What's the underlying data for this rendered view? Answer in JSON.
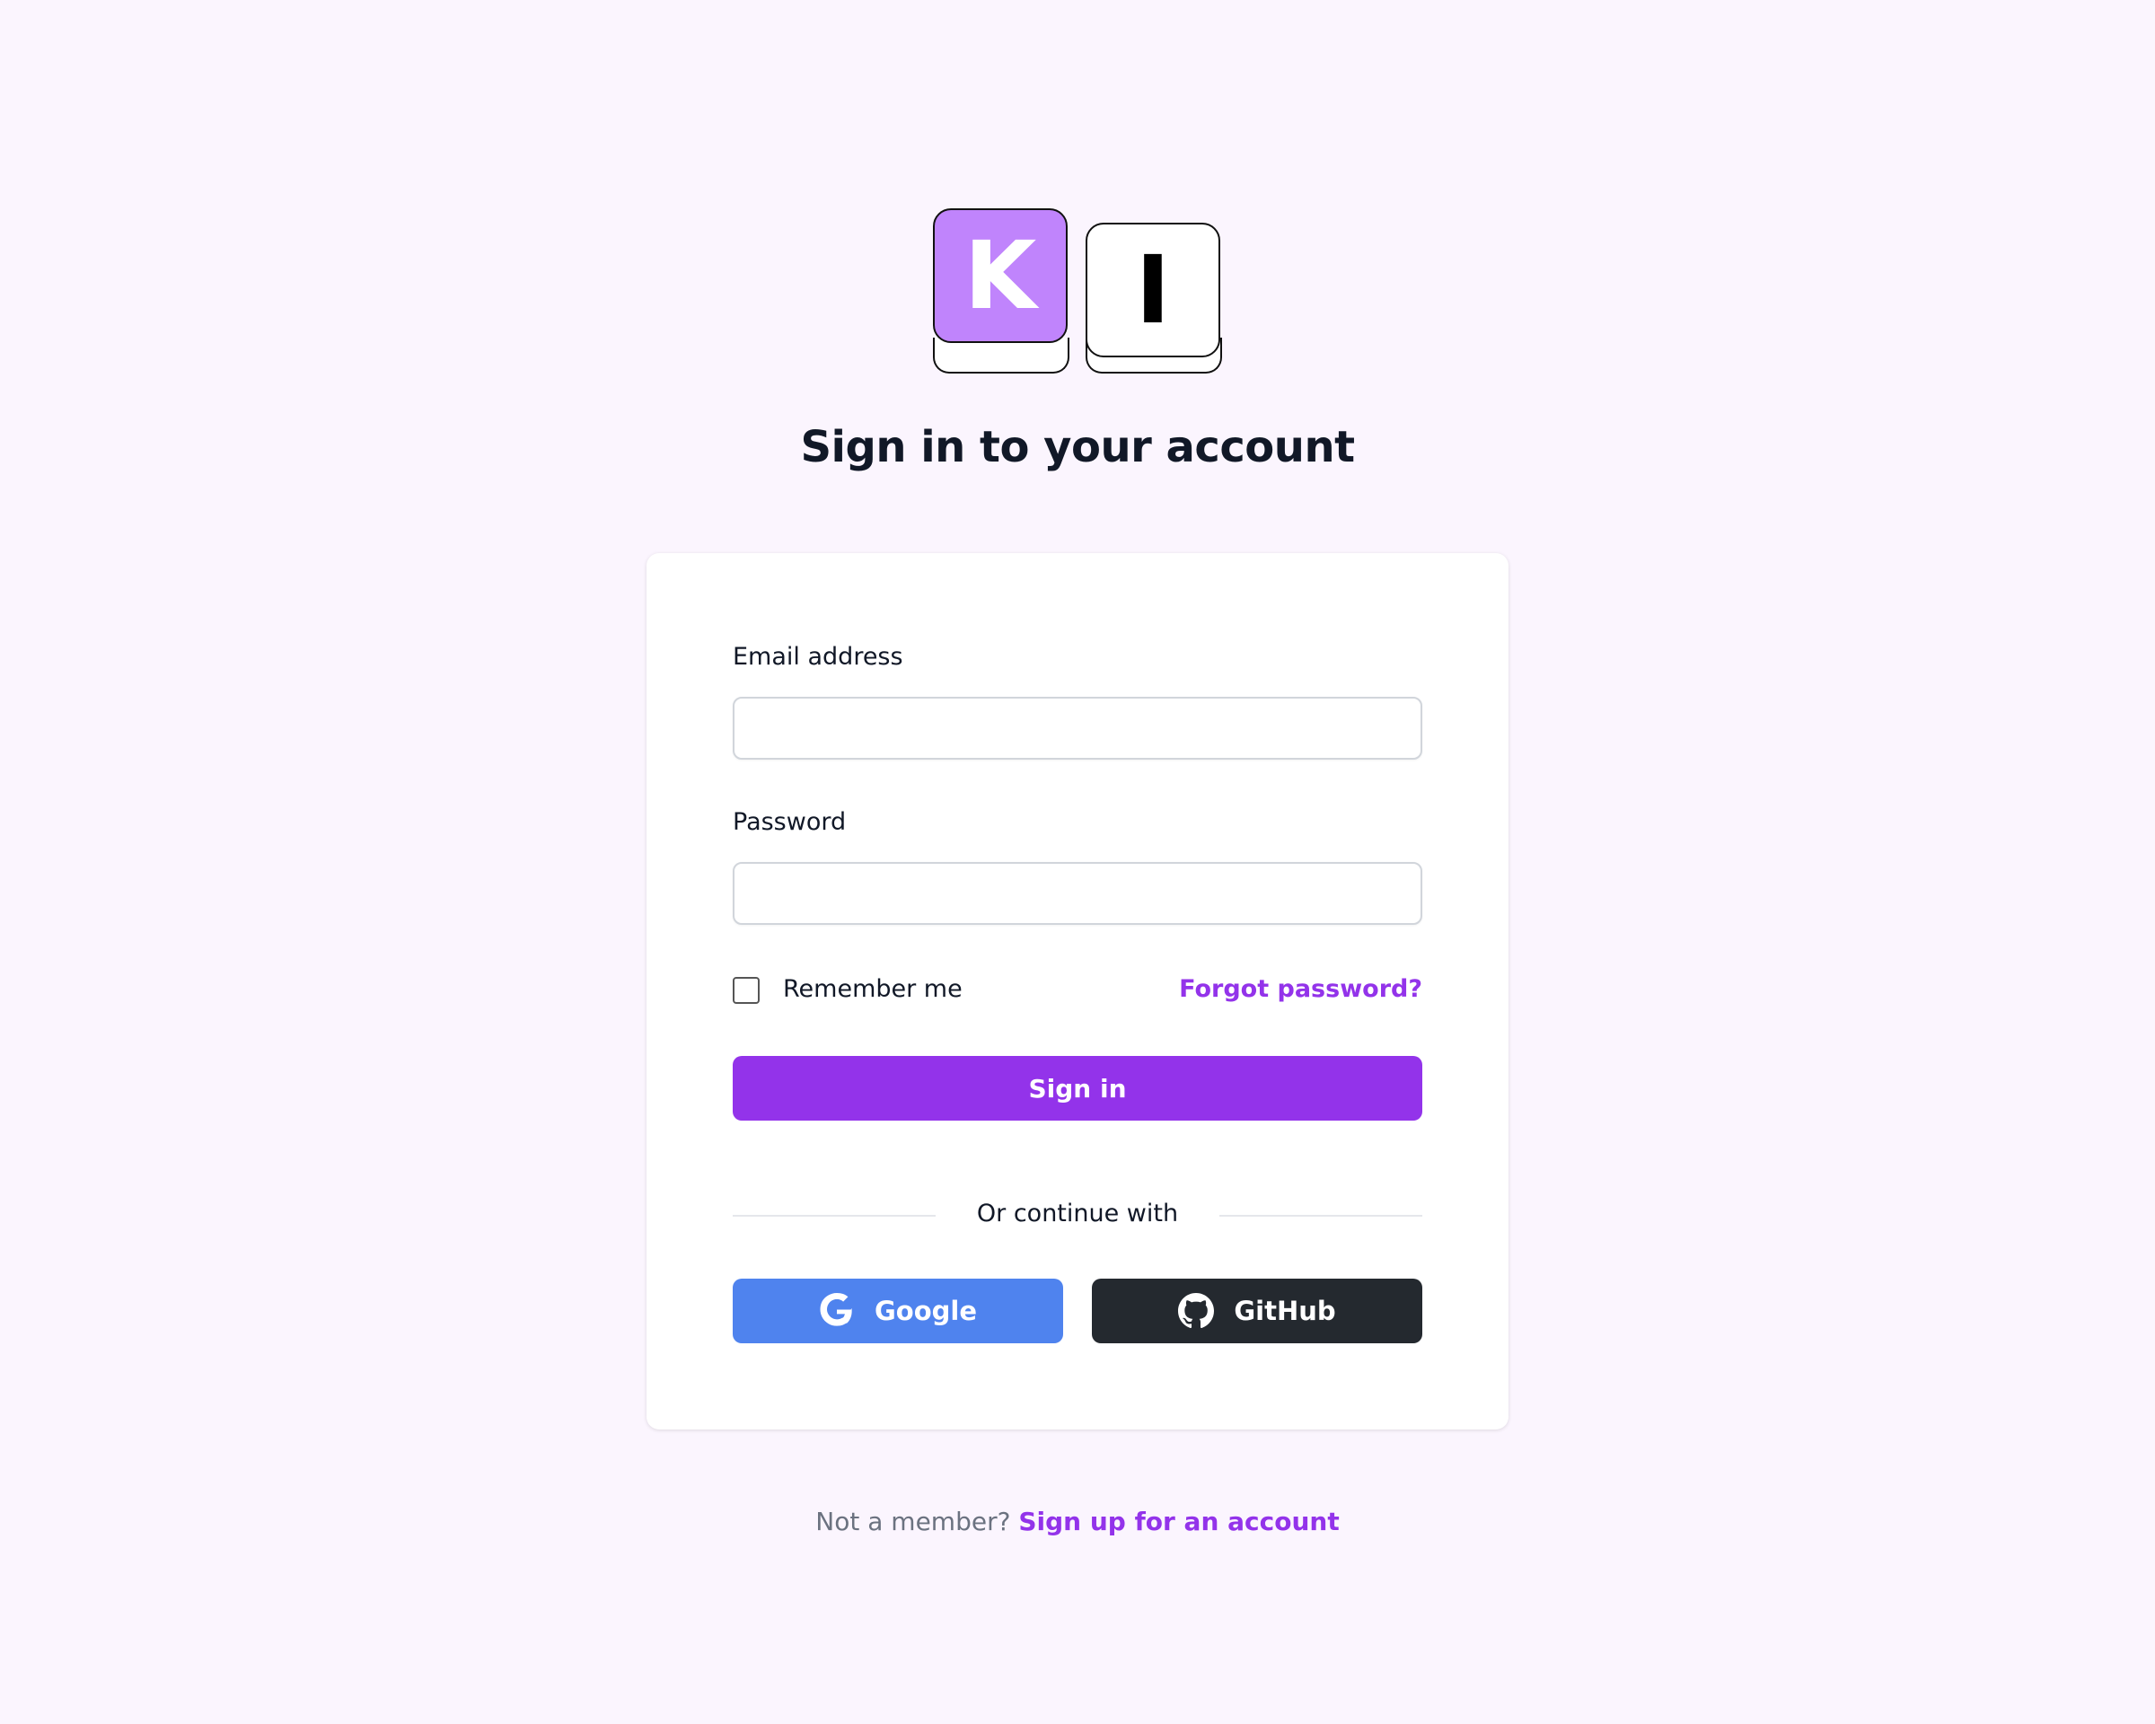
{
  "logo": {
    "letters": [
      "K",
      "I"
    ],
    "colors": {
      "k_bg": "#c084fc",
      "i_bg": "#ffffff"
    }
  },
  "header": {
    "title": "Sign in to your account"
  },
  "form": {
    "email_label": "Email address",
    "email_value": "",
    "password_label": "Password",
    "password_value": "",
    "remember_label": "Remember me",
    "remember_checked": false,
    "forgot_label": "Forgot password?",
    "submit_label": "Sign in"
  },
  "social": {
    "divider_text": "Or continue with",
    "google": {
      "label": "Google",
      "icon": "google-icon",
      "color": "#4f83ee"
    },
    "github": {
      "label": "GitHub",
      "icon": "github-icon",
      "color": "#24292f"
    }
  },
  "footer": {
    "prompt": "Not a member?",
    "link": "Sign up for an account"
  },
  "colors": {
    "accent": "#9333ea",
    "background": "#fbf5fe"
  }
}
